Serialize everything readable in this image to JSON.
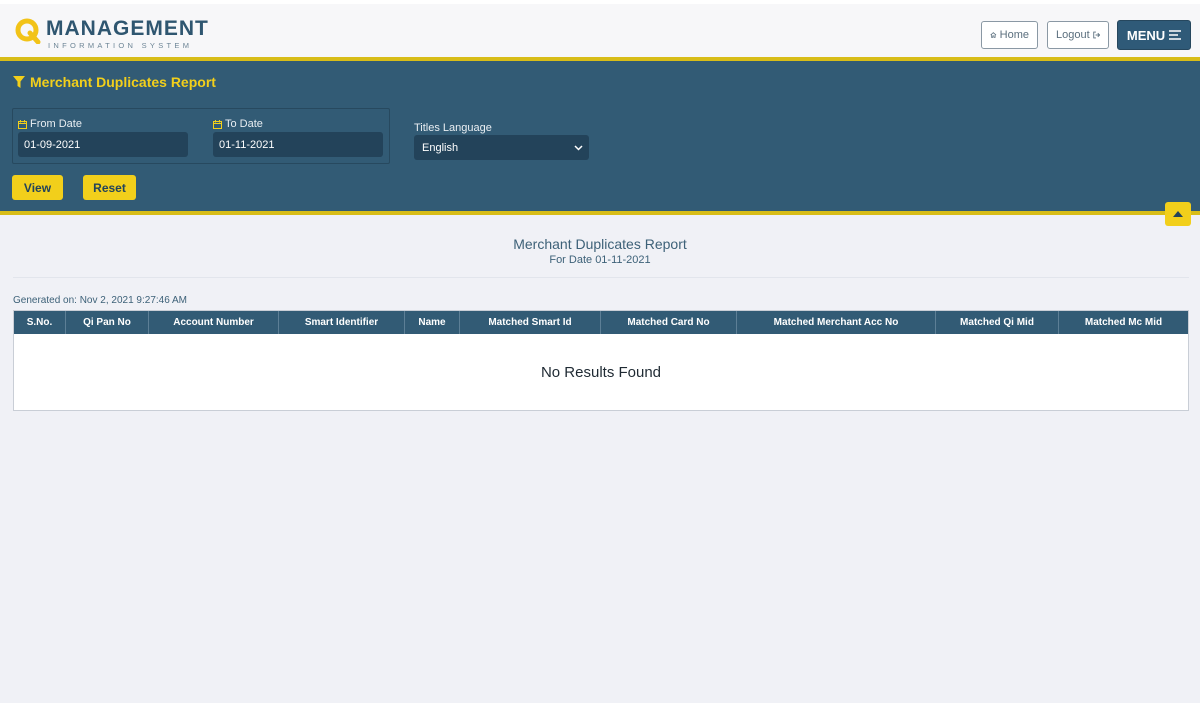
{
  "header": {
    "logo_main": "MANAGEMENT",
    "logo_sub": "INFORMATION SYSTEM",
    "home_label": "Home",
    "logout_label": "Logout",
    "menu_label": "MENU"
  },
  "filters": {
    "title": "Merchant Duplicates Report",
    "from_label": "From Date",
    "from_value": "01-09-2021",
    "to_label": "To Date",
    "to_value": "01-11-2021",
    "language_label": "Titles Language",
    "language_value": "English",
    "view_label": "View",
    "reset_label": "Reset"
  },
  "report": {
    "title": "Merchant Duplicates Report",
    "subtitle": "For Date 01-11-2021",
    "generated": "Generated on: Nov 2, 2021 9:27:46 AM",
    "columns": [
      "S.No.",
      "Qi Pan No",
      "Account Number",
      "Smart Identifier",
      "Name",
      "Matched Smart Id",
      "Matched Card No",
      "Matched Merchant Acc No",
      "Matched Qi Mid",
      "Matched Mc Mid"
    ],
    "empty_message": "No Results Found"
  },
  "colors": {
    "brand_dark": "#325b75",
    "accent_yellow": "#f2cf1b",
    "background": "#f0f1f6"
  },
  "icons": [
    "q-logo-icon",
    "home-icon",
    "logout-icon",
    "menu-bars-icon",
    "filter-icon",
    "calendar-icon",
    "chevron-down-icon",
    "caret-up-icon"
  ]
}
